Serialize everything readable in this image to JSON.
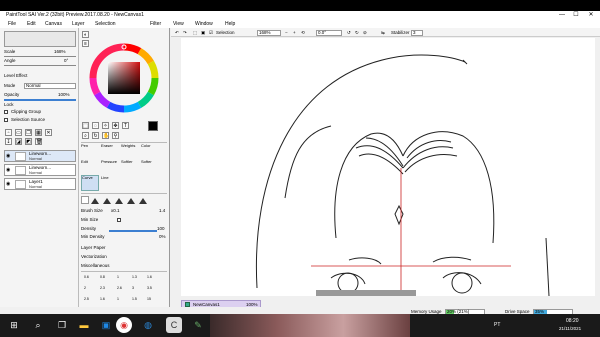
{
  "window": {
    "title": "PaintTool SAI Ver.2 (32bit) Preview.2017.08.20 - NewCanvas1",
    "minimize": "—",
    "maximize": "☐",
    "close": "✕"
  },
  "menu": [
    "File",
    "Edit",
    "Canvas",
    "Layer",
    "Selection",
    "Filter",
    "View",
    "Window",
    "Help"
  ],
  "left_panel": {
    "scale_label": "Scale",
    "scale_value": "168%",
    "angle_label": "Angle",
    "angle_value": "0°",
    "level_effect": "Level Effect",
    "mode_label": "Mode",
    "mode_value": "Normal",
    "opacity_label": "Opacity",
    "opacity_value": "100%",
    "lock_label": "Lock",
    "clipping_group": "Clipping Group",
    "selection_source": "Selection Source",
    "layers": [
      {
        "name": "Lineworn...",
        "mode": "Normal",
        "opacity": "100%"
      },
      {
        "name": "Lineworn...",
        "mode": "Normal",
        "opacity": "100%"
      },
      {
        "name": "Layer1",
        "mode": "Normal",
        "opacity": "100%"
      }
    ]
  },
  "tools": {
    "row1": [
      "Pen",
      "Eraser",
      "Weights",
      "Color"
    ],
    "row2": [
      "Edit",
      "Pressure",
      "Softler",
      "Softer"
    ],
    "row3": [
      "Curve",
      "Line",
      ""
    ],
    "text_tool": "T",
    "brush_size_label": "Brush Size",
    "brush_size_mult": "x0.1",
    "brush_size_value": "1.4",
    "min_size_label": "Min Size",
    "min_size_value": "0%",
    "density_label": "Density",
    "density_value": "100",
    "min_density_label": "Min Density",
    "min_density_value": "0%",
    "layer_paper": "Layer Paper",
    "vectorization": "Vectorization",
    "miscellaneous": "Miscellaneous",
    "sizes_row1": [
      "0.6",
      "0.8",
      "1",
      "1.3",
      "1.6"
    ],
    "sizes_row2": [
      "2",
      "2.3",
      "2.6",
      "3",
      "3.5"
    ],
    "sizes_row3": [
      "2.5",
      "1.6",
      "1",
      "1.5",
      "15"
    ]
  },
  "canvas_toolbar": {
    "selection_label": "Selection",
    "zoom": "168%",
    "angle": "0.0°",
    "stabilizer_label": "Stabilizer",
    "stabilizer_value": "3"
  },
  "navigator": {
    "canvas_name": "NewCanvas1",
    "zoom": "100%"
  },
  "status": {
    "memory_label": "Memory Usage",
    "memory_value": "20% (21%)",
    "drive_label": "Drive Space",
    "drive_value": "35%"
  },
  "taskbar": {
    "time": "08:20",
    "date": "21/11/2021",
    "lang": "PT"
  },
  "colors": {
    "accent": "#3c7fd1",
    "guide_red": "#cc2222"
  }
}
